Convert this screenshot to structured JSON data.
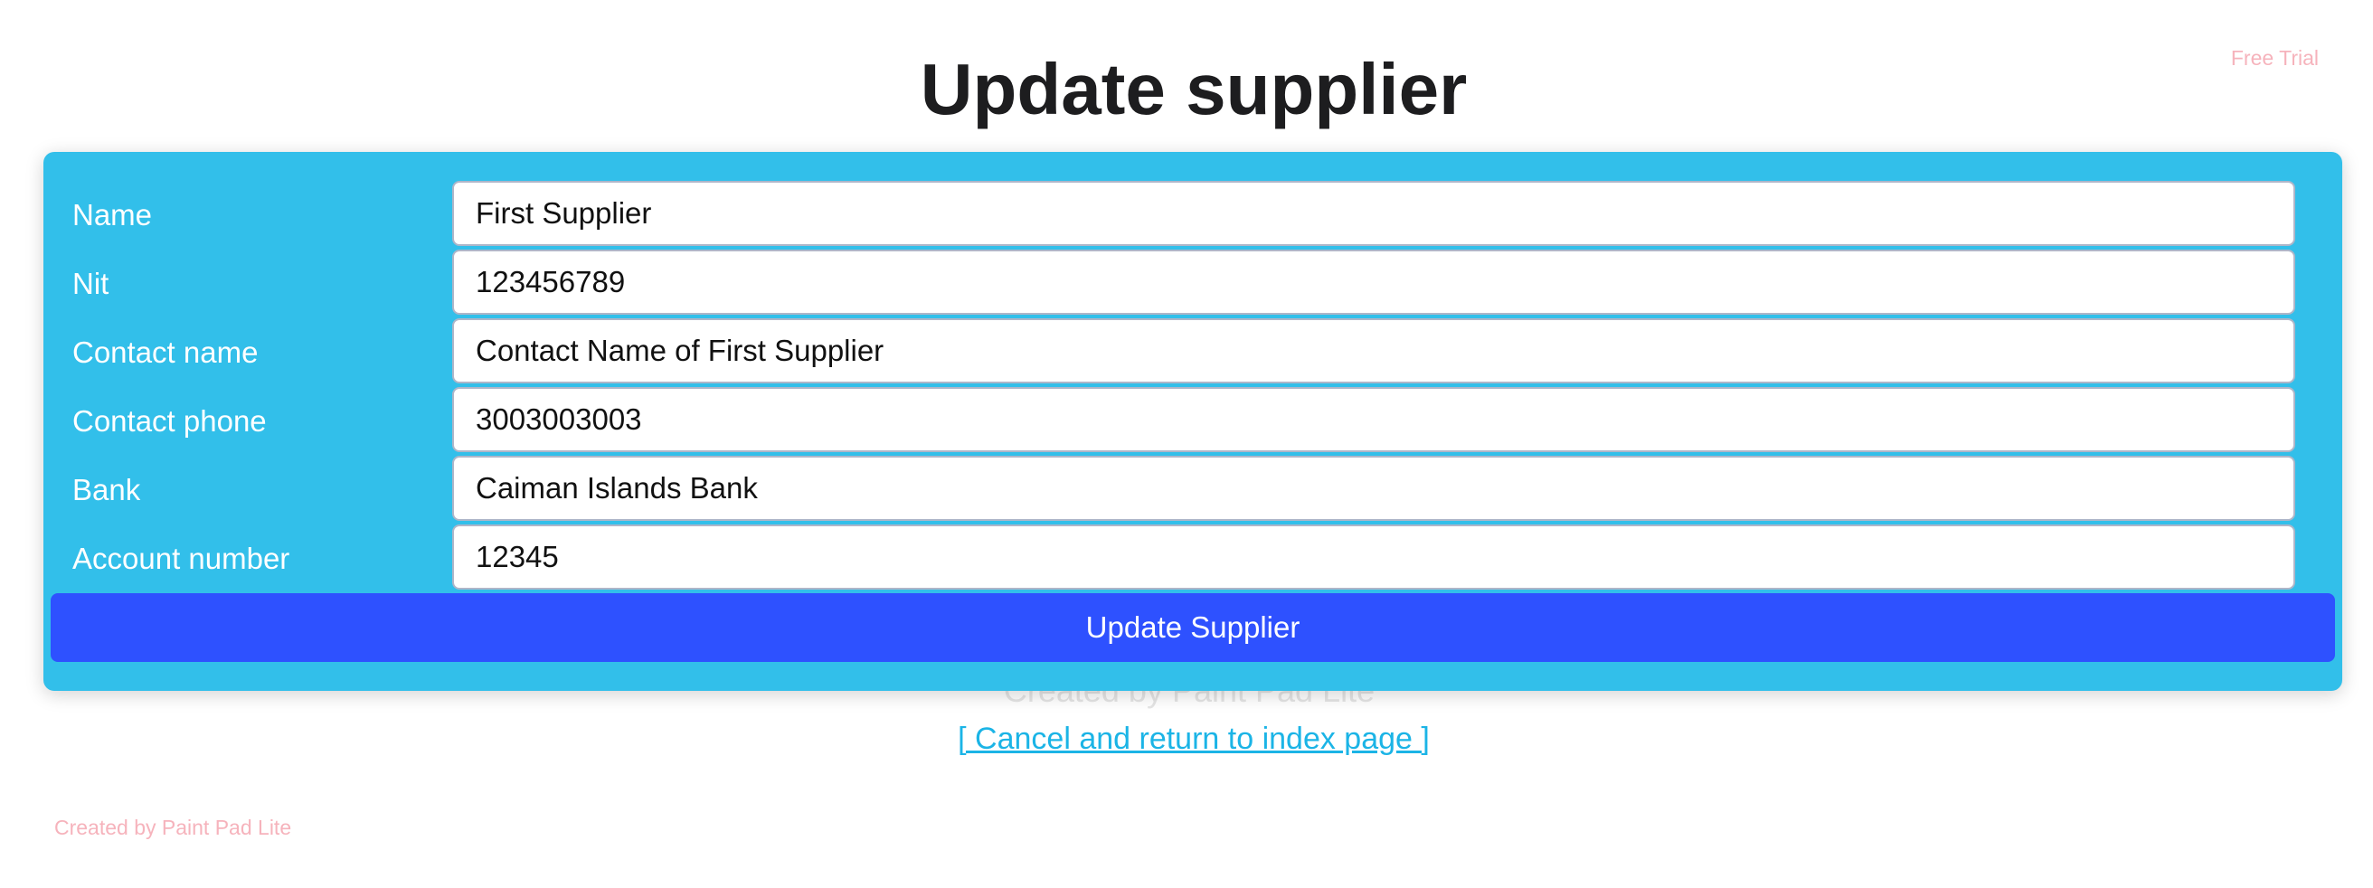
{
  "page": {
    "title": "Update supplier",
    "trial_badge": "Free Trial",
    "watermark_center": "Created by Paint Pad Lite",
    "watermark_bottom_left": "Created by Paint Pad Lite"
  },
  "form": {
    "fields": [
      {
        "label": "Name",
        "value": "First Supplier"
      },
      {
        "label": "Nit",
        "value": "123456789"
      },
      {
        "label": "Contact name",
        "value": "Contact Name of First Supplier"
      },
      {
        "label": "Contact phone",
        "value": "3003003003"
      },
      {
        "label": "Bank",
        "value": "Caiman Islands Bank"
      },
      {
        "label": "Account number",
        "value": "12345"
      }
    ],
    "submit_label": "Update Supplier"
  },
  "links": {
    "cancel": "[ Cancel and return to index page ]"
  },
  "colors": {
    "card_background": "#32bfea",
    "button_background": "#2e51ff",
    "link": "#1bb4e6",
    "watermark": "#f6b3bc"
  }
}
